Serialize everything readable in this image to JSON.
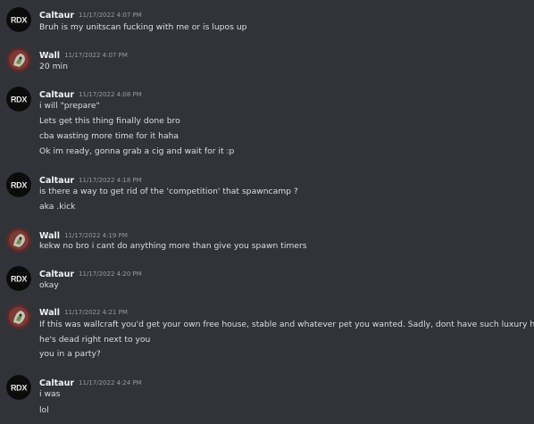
{
  "colors": {
    "background": "#313338",
    "username": "#f2f3f5",
    "timestamp": "#949ba4",
    "text": "#dbdee1",
    "avatar_rdx_bg": "#0b0b0b",
    "avatar_wall_bg": "#5b2a2a"
  },
  "messages": [
    {
      "author": "Caltaur",
      "avatar": "rdx-logo-avatar",
      "timestamp": "11/17/2022 4:07 PM",
      "lines": [
        "Bruh is my unitscan fucking with me or is lupos up"
      ]
    },
    {
      "author": "Wall",
      "avatar": "wall-character-avatar",
      "timestamp": "11/17/2022 4:07 PM",
      "lines": [
        "20 min"
      ]
    },
    {
      "author": "Caltaur",
      "avatar": "rdx-logo-avatar",
      "timestamp": "11/17/2022 4:08 PM",
      "lines": [
        "i will \"prepare\"",
        "Lets get this thing finally done bro",
        "cba wasting more time for it haha",
        "Ok im ready, gonna grab a cig and wait for it :p"
      ]
    },
    {
      "author": "Caltaur",
      "avatar": "rdx-logo-avatar",
      "timestamp": "11/17/2022 4:18 PM",
      "lines": [
        "is there a way to get rid of the 'competition' that spawncamp ?",
        "aka .kick"
      ]
    },
    {
      "author": "Wall",
      "avatar": "wall-character-avatar",
      "timestamp": "11/17/2022 4:19 PM",
      "lines": [
        "kekw no bro i cant do anything more than give you spawn timers"
      ]
    },
    {
      "author": "Caltaur",
      "avatar": "rdx-logo-avatar",
      "timestamp": "11/17/2022 4:20 PM",
      "lines": [
        "okay"
      ]
    },
    {
      "author": "Wall",
      "avatar": "wall-character-avatar",
      "timestamp": "11/17/2022 4:21 PM",
      "lines": [
        "If this was wallcraft you'd get your own free house, stable and whatever pet you wanted. Sadly, dont have such luxury here",
        "he's dead right next to you",
        "you in a party?"
      ]
    },
    {
      "author": "Caltaur",
      "avatar": "rdx-logo-avatar",
      "timestamp": "11/17/2022 4:24 PM",
      "lines": [
        "i was",
        "lol"
      ]
    }
  ]
}
